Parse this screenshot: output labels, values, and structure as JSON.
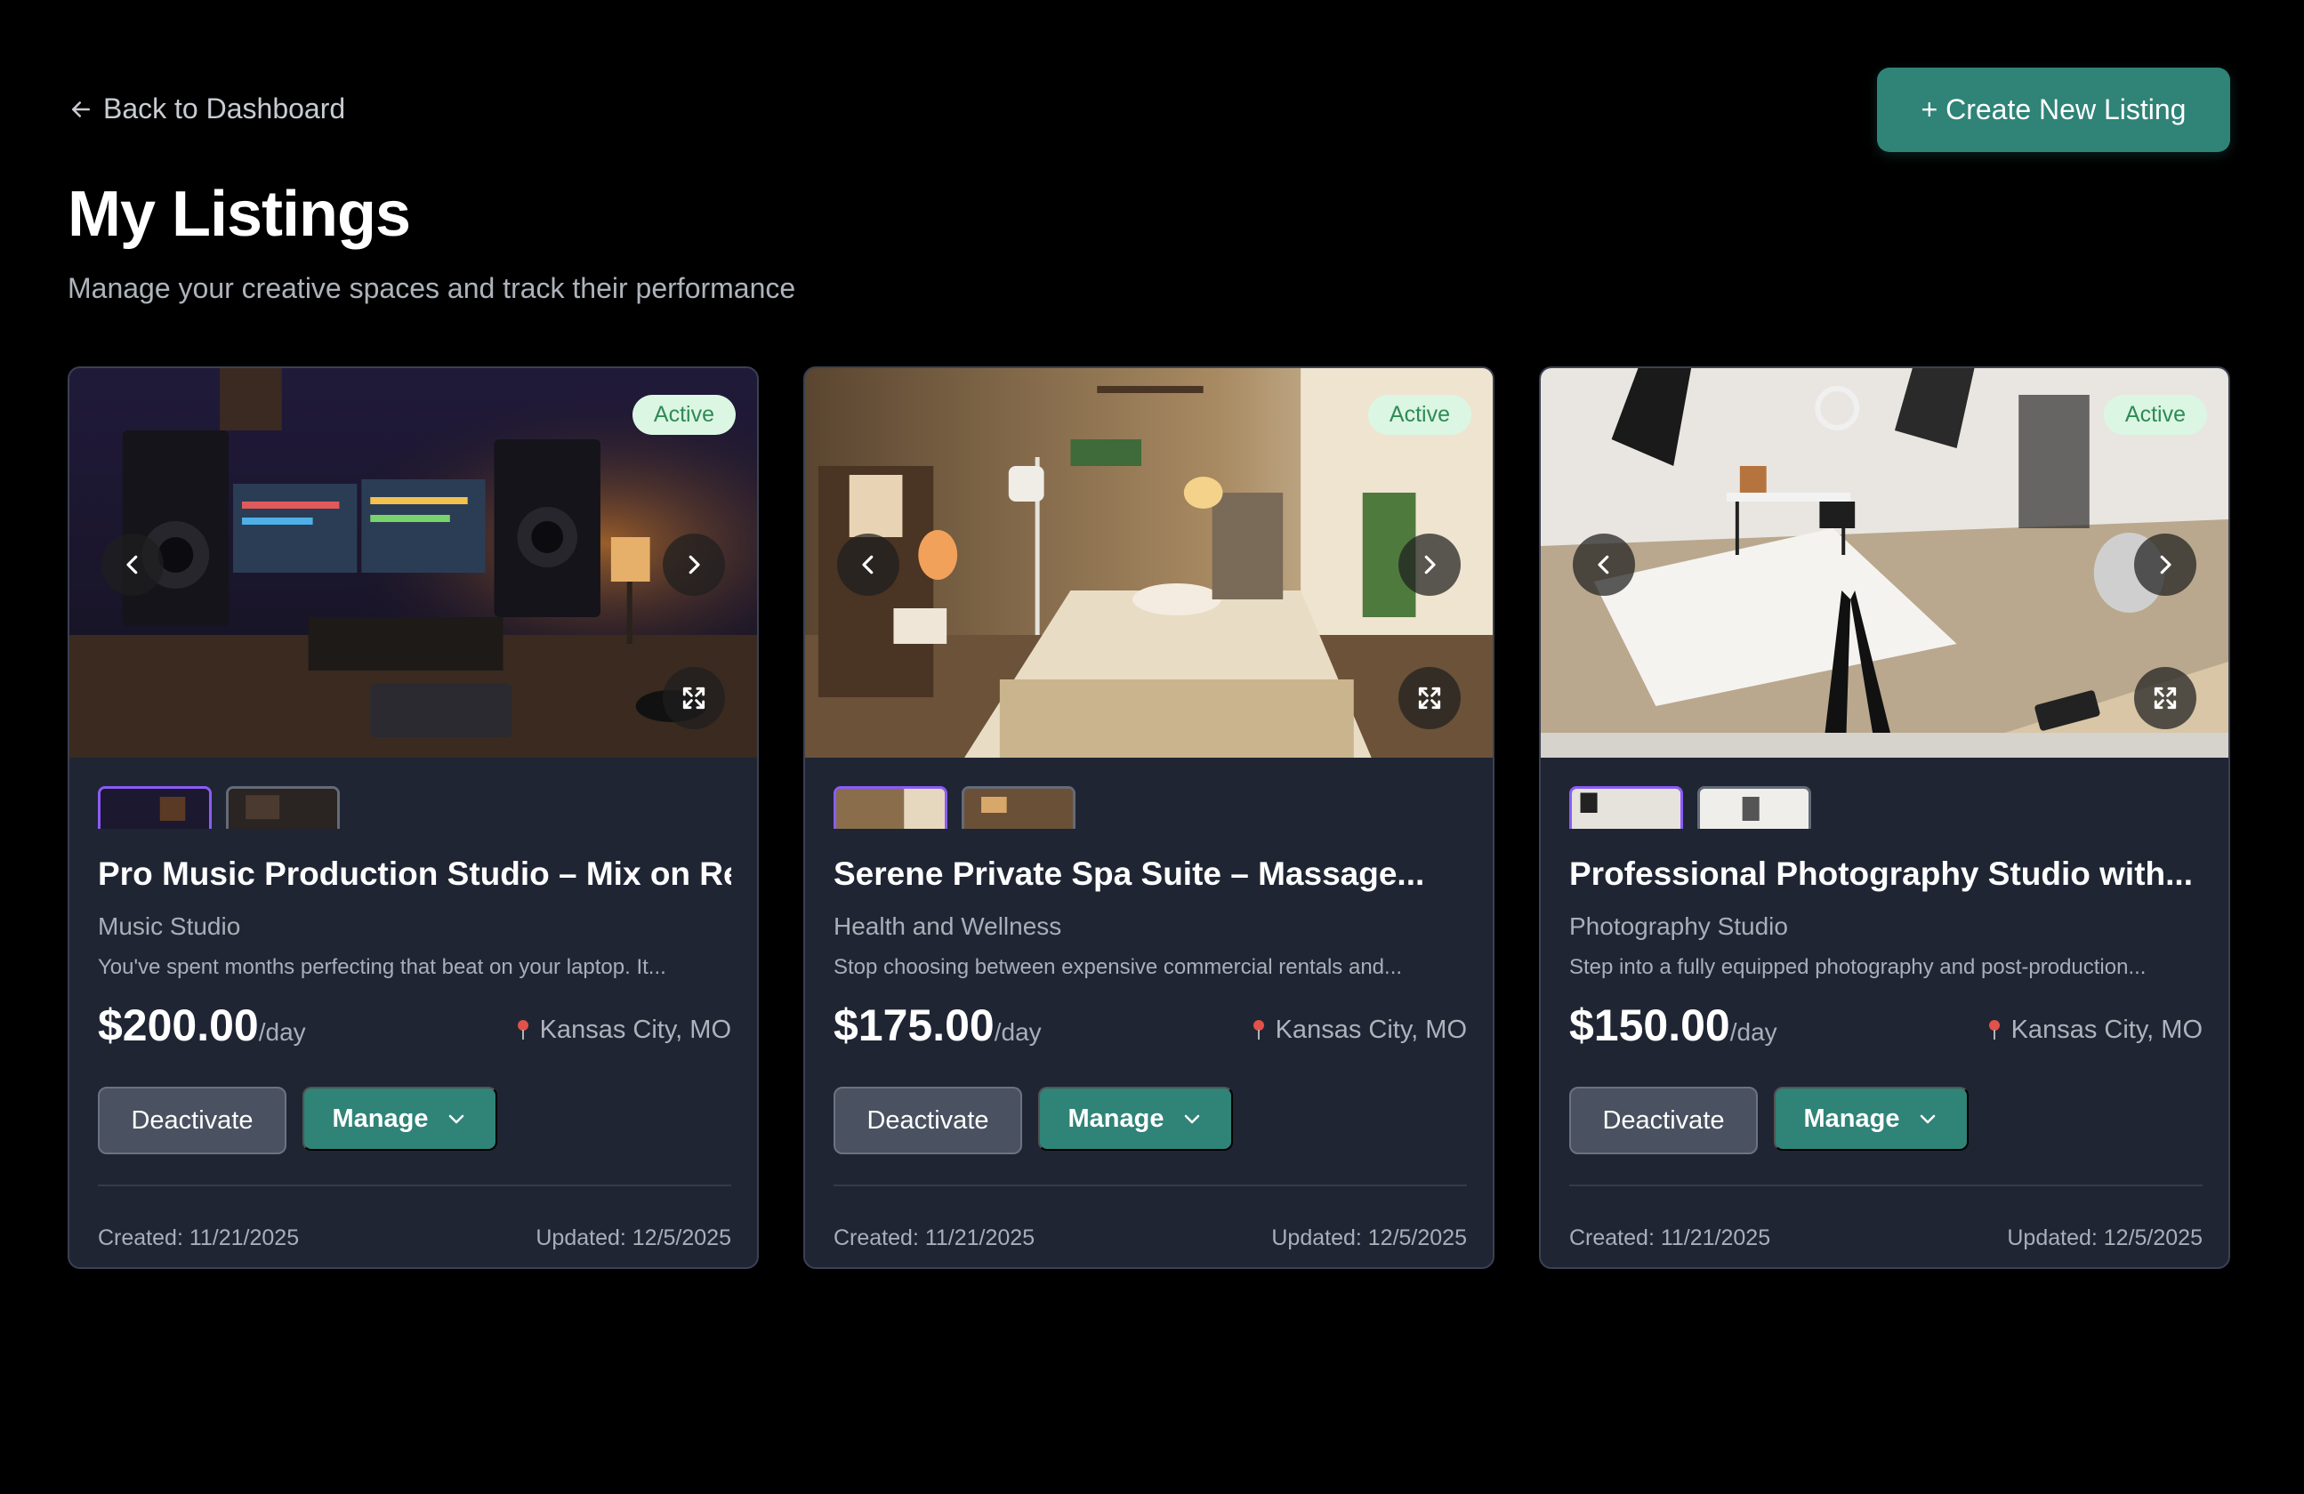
{
  "header": {
    "back_label": "Back to Dashboard",
    "create_label": "+ Create New Listing",
    "title": "My Listings",
    "subtitle": "Manage your creative spaces and track their performance"
  },
  "colors": {
    "accent": "#2f8377",
    "thumb_active_border": "#8b5cf6",
    "badge_bg": "#dcf6e4",
    "badge_text": "#2f8a55",
    "card_bg": "#1f2533",
    "pin": "#e0524b"
  },
  "listings": [
    {
      "status": "Active",
      "title": "Pro Music Production Studio – Mix on Re...",
      "category": "Music Studio",
      "description": "You've spent months perfecting that beat on your laptop. It...",
      "price": "$200.00",
      "per": "/day",
      "location": "Kansas City, MO",
      "deactivate_label": "Deactivate",
      "manage_label": "Manage",
      "created": "Created: 11/21/2025",
      "updated": "Updated: 12/5/2025",
      "image": "music-studio-photo"
    },
    {
      "status": "Active",
      "title": "Serene Private Spa Suite – Massage...",
      "category": "Health and Wellness",
      "description": "Stop choosing between expensive commercial rentals and...",
      "price": "$175.00",
      "per": "/day",
      "location": "Kansas City, MO",
      "deactivate_label": "Deactivate",
      "manage_label": "Manage",
      "created": "Created: 11/21/2025",
      "updated": "Updated: 12/5/2025",
      "image": "spa-suite-photo"
    },
    {
      "status": "Active",
      "title": "Professional Photography Studio with...",
      "category": "Photography Studio",
      "description": "Step into a fully equipped photography and post-production...",
      "price": "$150.00",
      "per": "/day",
      "location": "Kansas City, MO",
      "deactivate_label": "Deactivate",
      "manage_label": "Manage",
      "created": "Created: 11/21/2025",
      "updated": "Updated: 12/5/2025",
      "image": "photo-studio-photo"
    }
  ],
  "icons": {
    "back": "arrow-left-icon",
    "prev": "chevron-left-icon",
    "next": "chevron-right-icon",
    "expand": "expand-icon",
    "location": "map-pin-icon",
    "dropdown": "chevron-down-icon"
  }
}
